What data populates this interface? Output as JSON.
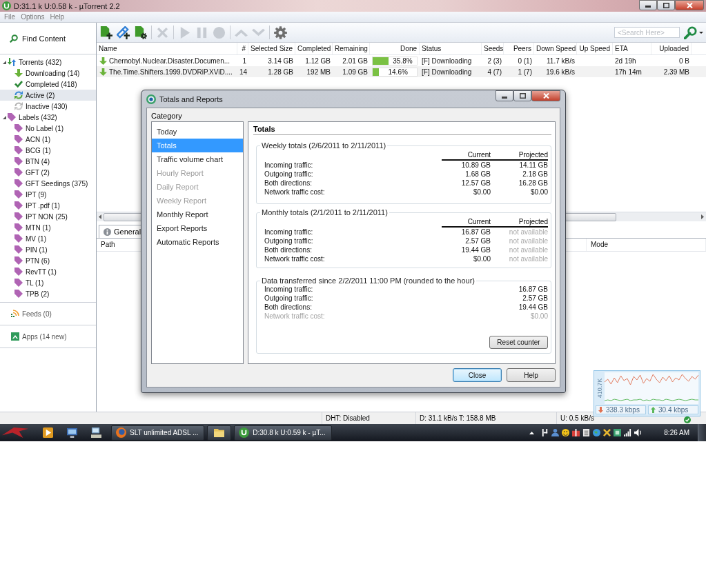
{
  "window": {
    "title": "D:31.1 k U:0.58 k - µTorrent 2.2"
  },
  "menu": [
    "File",
    "Options",
    "Help"
  ],
  "toolbar": [
    {
      "kind": "add-torrent",
      "disabled": false
    },
    {
      "kind": "add-url",
      "disabled": false
    },
    {
      "kind": "create-torrent",
      "disabled": false
    },
    {
      "kind": "remove",
      "disabled": true
    },
    {
      "kind": "start",
      "disabled": true
    },
    {
      "kind": "pause",
      "disabled": true
    },
    {
      "kind": "stop",
      "disabled": true
    },
    {
      "kind": "move-up",
      "disabled": true
    },
    {
      "kind": "move-down",
      "disabled": true
    },
    {
      "kind": "preferences",
      "disabled": false
    }
  ],
  "search": {
    "placeholder": "<Search Here>"
  },
  "sidebar": {
    "find_content": "Find Content",
    "tree": [
      {
        "label": "Torrents (432)",
        "kind": "torrents",
        "expanded": true,
        "selected": false,
        "children": [
          {
            "label": "Downloading (14)",
            "kind": "downloading",
            "selected": false
          },
          {
            "label": "Completed (418)",
            "kind": "completed",
            "selected": false
          },
          {
            "label": "Active (2)",
            "kind": "active",
            "selected": true
          },
          {
            "label": "Inactive (430)",
            "kind": "inactive",
            "selected": false
          }
        ]
      },
      {
        "label": "Labels (432)",
        "kind": "labels",
        "expanded": true,
        "selected": false,
        "children": [
          {
            "label": "No Label (1)",
            "kind": "label",
            "selected": false
          },
          {
            "label": "ACN (1)",
            "kind": "label",
            "selected": false
          },
          {
            "label": "BCG (1)",
            "kind": "label",
            "selected": false
          },
          {
            "label": "BTN (4)",
            "kind": "label",
            "selected": false
          },
          {
            "label": "GFT (2)",
            "kind": "label",
            "selected": false
          },
          {
            "label": "GFT Seedings (375)",
            "kind": "label",
            "selected": false
          },
          {
            "label": "IPT (9)",
            "kind": "label",
            "selected": false
          },
          {
            "label": "IPT .pdf (1)",
            "kind": "label",
            "selected": false
          },
          {
            "label": "IPT NON (25)",
            "kind": "label",
            "selected": false
          },
          {
            "label": "MTN (1)",
            "kind": "label",
            "selected": false
          },
          {
            "label": "MV (1)",
            "kind": "label",
            "selected": false
          },
          {
            "label": "PIN (1)",
            "kind": "label",
            "selected": false
          },
          {
            "label": "PTN (6)",
            "kind": "label",
            "selected": false
          },
          {
            "label": "RevTT (1)",
            "kind": "label",
            "selected": false
          },
          {
            "label": "TL (1)",
            "kind": "label",
            "selected": false
          },
          {
            "label": "TPB (2)",
            "kind": "label",
            "selected": false
          }
        ]
      }
    ],
    "feeds": {
      "label": "Feeds (0)",
      "selected": false
    },
    "apps": {
      "label": "Apps (14 new)",
      "selected": false
    }
  },
  "torrents": {
    "columns": [
      "Name",
      "#",
      "Selected Size",
      "Completed",
      "Remaining",
      "Done",
      "Status",
      "Seeds",
      "Peers",
      "Down Speed",
      "Up Speed",
      "ETA",
      "Uploaded"
    ],
    "rows": [
      {
        "name": "Chernobyl.Nuclear.Disaster.Documen...",
        "number": "1",
        "selected_size": "3.14 GB",
        "completed": "1.12 GB",
        "remaining": "2.01 GB",
        "done": "35.8%",
        "level": 0.358,
        "status": "[F] Downloading",
        "seeds": "2 (3)",
        "peers": "0 (1)",
        "down_speed": "11.7 kB/s",
        "eta": "2d 19h",
        "uploaded": "0 B",
        "selected": false
      },
      {
        "name": "The.Time.Shifters.1999.DVDRiP.XViD....",
        "number": "14",
        "selected_size": "1.28 GB",
        "completed": "192 MB",
        "remaining": "1.09 GB",
        "done": "14.6%",
        "level": 0.146,
        "status": "[F] Downloading",
        "seeds": "4 (7)",
        "peers": "1 (7)",
        "down_speed": "19.6 kB/s",
        "eta": "17h 14m",
        "uploaded": "2.39 MB",
        "selected": false
      }
    ]
  },
  "details": {
    "tabs": [
      {
        "label": "General",
        "selected": true
      }
    ],
    "columns": [
      "Path",
      "Mode"
    ]
  },
  "status_bar": {
    "dht": "DHT: Disabled",
    "download": "D: 31.1 kB/s T: 158.8 MB",
    "upload": "U: 0.5 kB/s"
  },
  "speed_graph": {
    "scale": "410.7K",
    "download": "338.3 kbps",
    "upload": "30.4 kbps"
  },
  "dialog": {
    "title": "Totals and Reports",
    "category_label": "Category",
    "categories": [
      {
        "label": "Today",
        "selected": false,
        "disabled": false
      },
      {
        "label": "Totals",
        "selected": true,
        "disabled": false
      },
      {
        "label": "Traffic volume chart",
        "selected": false,
        "disabled": false
      },
      {
        "label": "Hourly Report",
        "selected": false,
        "disabled": true
      },
      {
        "label": "Daily Report",
        "selected": false,
        "disabled": true
      },
      {
        "label": "Weekly Report",
        "selected": false,
        "disabled": true
      },
      {
        "label": "Monthly Report",
        "selected": false,
        "disabled": false
      },
      {
        "label": "Export Reports",
        "selected": false,
        "disabled": false
      },
      {
        "label": "Automatic Reports",
        "selected": false,
        "disabled": false
      }
    ],
    "panel_title": "Totals",
    "sections": [
      {
        "title": "Weekly totals (2/6/2011 to 2/11/2011)",
        "columns": [
          "Current",
          "Projected"
        ],
        "projected_disabled": false,
        "rows": [
          {
            "label": "Incoming traffic:",
            "current": "10.89 GB",
            "projected": "14.11 GB",
            "disabled": false
          },
          {
            "label": "Outgoing traffic:",
            "current": "1.68 GB",
            "projected": "2.18 GB",
            "disabled": false
          },
          {
            "label": "Both directions:",
            "current": "12.57 GB",
            "projected": "16.28 GB",
            "disabled": false
          },
          {
            "label": "Network traffic cost:",
            "current": "$0.00",
            "projected": "$0.00",
            "disabled": false
          }
        ]
      },
      {
        "title": "Monthly totals (2/1/2011 to 2/11/2011)",
        "columns": [
          "Current",
          "Projected"
        ],
        "projected_disabled": true,
        "rows": [
          {
            "label": "Incoming traffic:",
            "current": "16.87 GB",
            "projected": "not available",
            "disabled": false
          },
          {
            "label": "Outgoing traffic:",
            "current": "2.57 GB",
            "projected": "not available",
            "disabled": false
          },
          {
            "label": "Both directions:",
            "current": "19.44 GB",
            "projected": "not available",
            "disabled": false
          },
          {
            "label": "Network traffic cost:",
            "current": "$0.00",
            "projected": "not available",
            "disabled": false
          }
        ]
      },
      {
        "title": "Data transferred since 2/2/2011 11:00 PM (rounded to the hour)",
        "rows": [
          {
            "label": "Incoming traffic:",
            "current": "16.87 GB",
            "disabled": false
          },
          {
            "label": "Outgoing traffic:",
            "current": "2.57 GB",
            "disabled": false
          },
          {
            "label": "Both directions:",
            "current": "19.44 GB",
            "disabled": false
          },
          {
            "label": "Network traffic cost:",
            "current": "$0.00",
            "disabled": true
          }
        ],
        "button": "Reset counter"
      }
    ],
    "buttons": [
      {
        "label": "Close",
        "default": true
      },
      {
        "label": "Help",
        "default": false
      }
    ]
  },
  "taskbar": {
    "tasks": [
      {
        "kind": "browser",
        "label": "SLT unlimited ADSL ..."
      },
      {
        "kind": "folder"
      },
      {
        "kind": "torrent",
        "label": "D:30.8 k U:0.59 k - µT..."
      }
    ],
    "clock": "8:26 AM"
  }
}
